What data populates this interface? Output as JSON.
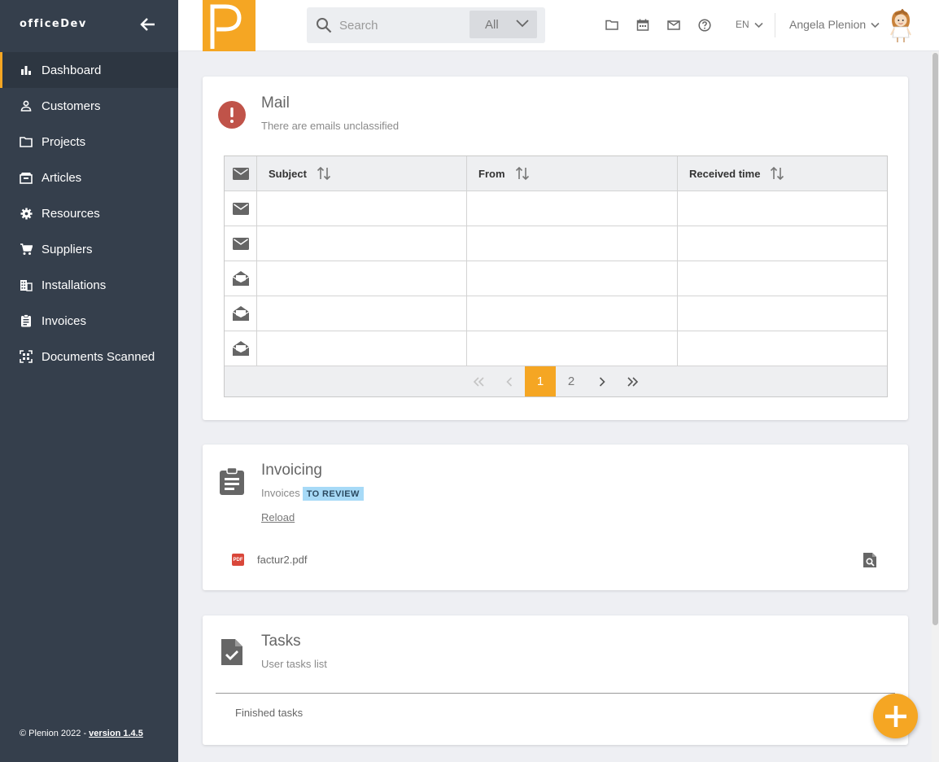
{
  "app": {
    "brand": "officeDev",
    "logo_letter": "P",
    "accent": "#f5a623",
    "sidebar_bg": "#353f4c"
  },
  "sidebar": {
    "items": [
      {
        "label": "Dashboard",
        "icon": "bar-chart-icon",
        "active": true
      },
      {
        "label": "Customers",
        "icon": "person-icon"
      },
      {
        "label": "Projects",
        "icon": "folder-icon"
      },
      {
        "label": "Articles",
        "icon": "box-icon"
      },
      {
        "label": "Resources",
        "icon": "gear-icon"
      },
      {
        "label": "Suppliers",
        "icon": "cart-icon"
      },
      {
        "label": "Installations",
        "icon": "building-icon"
      },
      {
        "label": "Invoices",
        "icon": "clipboard-icon"
      },
      {
        "label": "Documents Scanned",
        "icon": "scan-icon"
      }
    ],
    "footer_text": "© Plenion 2022 - ",
    "version": "version 1.4.5"
  },
  "topbar": {
    "search_placeholder": "Search",
    "search_scope": "All",
    "language": "EN",
    "user_name": "Angela Plenion"
  },
  "mail": {
    "title": "Mail",
    "subtitle": "There are emails unclassified",
    "columns": [
      "Subject",
      "From",
      "Received time"
    ],
    "rows": [
      {
        "status": "unread"
      },
      {
        "status": "unread"
      },
      {
        "status": "read"
      },
      {
        "status": "read"
      },
      {
        "status": "read"
      }
    ],
    "pagination": {
      "first": "«",
      "prev": "‹",
      "pages": [
        "1",
        "2"
      ],
      "current": "1",
      "next": "›",
      "last": "»"
    }
  },
  "invoicing": {
    "title": "Invoicing",
    "subtitle": "Invoices",
    "badge": "TO REVIEW",
    "reload": "Reload",
    "file_type": "PDF",
    "file_name": "factur2.pdf"
  },
  "tasks": {
    "title": "Tasks",
    "subtitle": "User tasks list",
    "finished": "Finished tasks"
  }
}
